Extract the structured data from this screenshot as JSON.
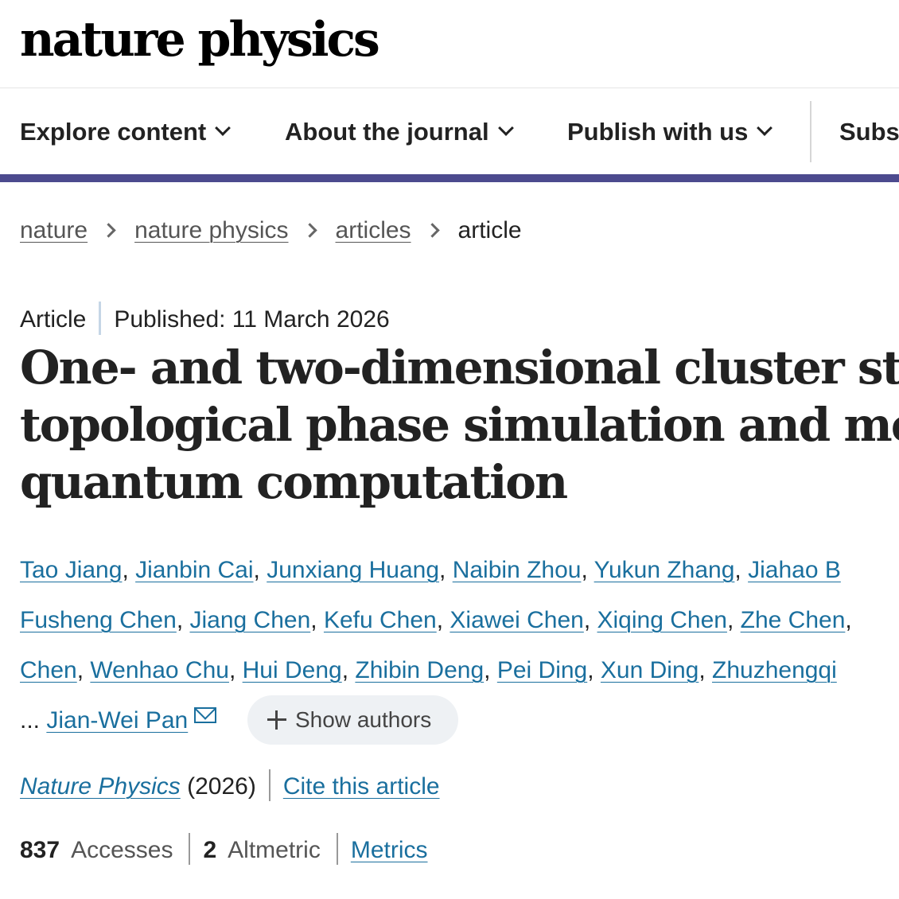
{
  "header": {
    "logo_text": "nature physics"
  },
  "nav": {
    "items": [
      {
        "label": "Explore content",
        "icon": "chevron-down-icon"
      },
      {
        "label": "About the journal",
        "icon": "chevron-down-icon"
      },
      {
        "label": "Publish with us",
        "icon": "chevron-down-icon"
      },
      {
        "label": "Subs"
      }
    ],
    "accent_color": "#4c4a8e"
  },
  "breadcrumb": {
    "items": [
      "nature",
      "nature physics",
      "articles"
    ],
    "current": "article"
  },
  "article": {
    "type": "Article",
    "published": "Published: 11 March 2026",
    "title_lines": [
      "One- and two-dimensional cluster states f",
      "topological phase simulation and measur",
      "quantum computation"
    ]
  },
  "authors": {
    "line1": [
      "Tao Jiang",
      "Jianbin Cai",
      "Junxiang Huang",
      "Naibin Zhou",
      "Yukun Zhang",
      "Jiahao B"
    ],
    "line2": [
      "Fusheng Chen",
      "Jiang Chen",
      "Kefu Chen",
      "Xiawei Chen",
      "Xiqing Chen",
      "Zhe Chen"
    ],
    "line3": [
      "Chen",
      "Wenhao Chu",
      "Hui Deng",
      "Zhibin Deng",
      "Pei Ding",
      "Xun Ding",
      "Zhuzhengqi"
    ],
    "ellipsis": "...",
    "last_author": "Jian-Wei Pan",
    "show_authors_label": "Show authors",
    "link_color": "#1a6f9e"
  },
  "journal": {
    "name": "Nature Physics",
    "year": "(2026)",
    "cite_label": "Cite this article"
  },
  "metrics": {
    "accesses_count": "837",
    "accesses_label": "Accesses",
    "altmetric_count": "2",
    "altmetric_label": "Altmetric",
    "metrics_link": "Metrics"
  }
}
